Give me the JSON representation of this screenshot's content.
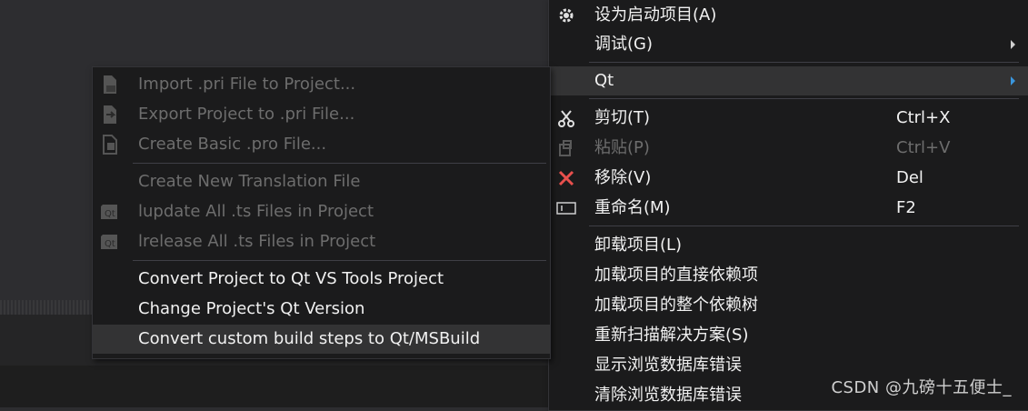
{
  "context_menu": {
    "set_startup": "设为启动项目(A)",
    "debug": "调试(G)",
    "qt": "Qt",
    "cut": "剪切(T)",
    "cut_shortcut": "Ctrl+X",
    "paste": "粘贴(P)",
    "paste_shortcut": "Ctrl+V",
    "remove": "移除(V)",
    "remove_shortcut": "Del",
    "rename": "重命名(M)",
    "rename_shortcut": "F2",
    "unload": "卸载项目(L)",
    "load_direct": "加载项目的直接依赖项",
    "load_tree": "加载项目的整个依赖树",
    "rescan": "重新扫描解决方案(S)",
    "show_db_errors": "显示浏览数据库错误",
    "clear_db_errors": "清除浏览数据库错误"
  },
  "qt_submenu": {
    "import_pri": "Import .pri File to Project...",
    "export_pri": "Export Project to .pri File...",
    "create_pro": "Create Basic .pro File...",
    "create_translation": "Create New Translation File",
    "lupdate": "lupdate All .ts Files in Project",
    "lrelease": "lrelease All .ts Files in Project",
    "convert_project": "Convert Project to Qt VS Tools Project",
    "change_version": "Change Project's Qt Version",
    "convert_build_steps": "Convert custom build steps to Qt/MSBuild"
  },
  "watermark": "CSDN @九磅十五便士_",
  "colors": {
    "menu_bg": "#1b1b1c",
    "hover_bg": "#333334",
    "disabled_text": "#6d6d6d",
    "remove_icon": "#e8504d",
    "submenu_arrow_active": "#3a96dd"
  }
}
